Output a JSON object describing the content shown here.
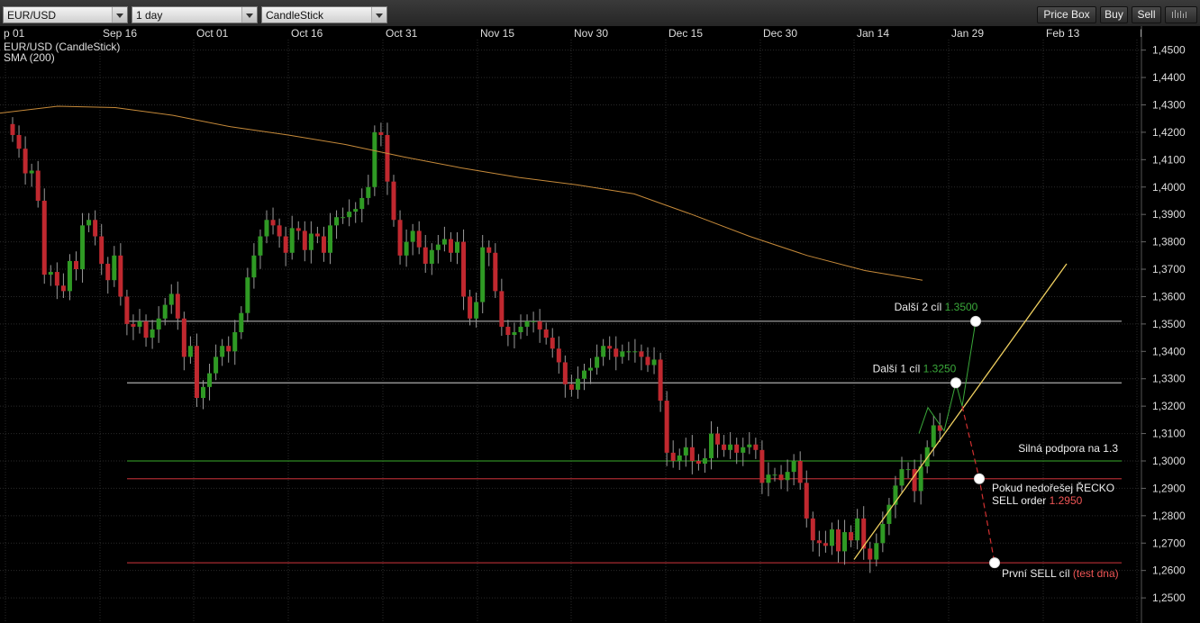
{
  "toolbar": {
    "symbol": "EUR/USD",
    "interval": "1 day",
    "chart_type": "CandleStick",
    "price_box_label": "Price Box",
    "buy_label": "Buy",
    "sell_label": "Sell",
    "settings_icon": "bars-icon"
  },
  "colors": {
    "background": "#000000",
    "grid": "#2a2a2a",
    "up_candle": "#2f9a24",
    "down_candle": "#c0282f",
    "sma": "#c68a3a",
    "level_white": "#aaaaaa",
    "level_green": "#2f8a23",
    "level_red": "#a82a30",
    "trendline": "#f0d060",
    "accent_green": "#33bb33",
    "accent_red": "#ee4444"
  },
  "chart_data": {
    "type": "candlestick",
    "series_label": "EUR/USD (CandleStick)",
    "sma_label": "SMA (200)",
    "x_ticks": [
      "p 01",
      "Sep 16",
      "Oct 01",
      "Oct 16",
      "Oct 31",
      "Nov 15",
      "Nov 30",
      "Dec 15",
      "Dec 30",
      "Jan 14",
      "Jan 29",
      "Feb 13",
      "Feb"
    ],
    "y_ticks": [
      "1,4500",
      "1,4400",
      "1,4300",
      "1,4200",
      "1,4100",
      "1,4000",
      "1,3900",
      "1,3800",
      "1,3700",
      "1,3600",
      "1,3500",
      "1,3400",
      "1,3300",
      "1,3200",
      "1,3100",
      "1,3000",
      "1,2900",
      "1,2800",
      "1,2700",
      "1,2600",
      "1,2500"
    ],
    "ylim": [
      1.2405,
      1.4535
    ],
    "closes": [
      1.419,
      1.414,
      1.405,
      1.406,
      1.395,
      1.368,
      1.369,
      1.364,
      1.362,
      1.373,
      1.37,
      1.386,
      1.388,
      1.382,
      1.372,
      1.366,
      1.375,
      1.36,
      1.35,
      1.349,
      1.351,
      1.345,
      1.348,
      1.352,
      1.357,
      1.361,
      1.352,
      1.338,
      1.342,
      1.323,
      1.327,
      1.332,
      1.338,
      1.342,
      1.34,
      1.347,
      1.354,
      1.367,
      1.375,
      1.382,
      1.388,
      1.386,
      1.382,
      1.376,
      1.385,
      1.384,
      1.377,
      1.383,
      1.382,
      1.376,
      1.386,
      1.389,
      1.389,
      1.391,
      1.392,
      1.396,
      1.4,
      1.42,
      1.419,
      1.402,
      1.388,
      1.375,
      1.38,
      1.384,
      1.378,
      1.372,
      1.377,
      1.379,
      1.381,
      1.376,
      1.38,
      1.36,
      1.352,
      1.358,
      1.378,
      1.376,
      1.362,
      1.349,
      1.346,
      1.347,
      1.349,
      1.351,
      1.351,
      1.348,
      1.345,
      1.341,
      1.336,
      1.328,
      1.326,
      1.33,
      1.333,
      1.334,
      1.338,
      1.342,
      1.341,
      1.338,
      1.34,
      1.34,
      1.34,
      1.338,
      1.335,
      1.337,
      1.322,
      1.303,
      1.3,
      1.302,
      1.305,
      1.3,
      1.299,
      1.301,
      1.31,
      1.306,
      1.304,
      1.306,
      1.303,
      1.305,
      1.306,
      1.304,
      1.292,
      1.295,
      1.295,
      1.293,
      1.296,
      1.3,
      1.292,
      1.279,
      1.271,
      1.27,
      1.269,
      1.275,
      1.267,
      1.274,
      1.271,
      1.279,
      1.268,
      1.264,
      1.27,
      1.277,
      1.284,
      1.291,
      1.297,
      1.297,
      1.289,
      1.298,
      1.305,
      1.313,
      1.311
    ],
    "sma_values": [
      1.427,
      1.4295,
      1.429,
      1.4262,
      1.422,
      1.419,
      1.4155,
      1.411,
      1.407,
      1.4035,
      1.4008,
      1.3975,
      1.39,
      1.382,
      1.375,
      1.3695,
      1.366
    ],
    "levels": [
      {
        "name": "Další 2 cíl",
        "price_label": "1.3500",
        "value": 1.351,
        "color": "white"
      },
      {
        "name": "Další 1 cíl",
        "price_label": "1.3250",
        "value": 1.3285,
        "color": "white"
      },
      {
        "name": "Silná podpora na 1.3",
        "price_label": "",
        "value": 1.3,
        "color": "green"
      },
      {
        "name": "Pokud nedořešej ŘECKO",
        "line2": "SELL order",
        "price_label": "1.2950",
        "value": 1.2935,
        "color": "red"
      },
      {
        "name": "První SELL cíl",
        "price_label": "(test dna)",
        "value": 1.2628,
        "color": "red"
      }
    ]
  }
}
